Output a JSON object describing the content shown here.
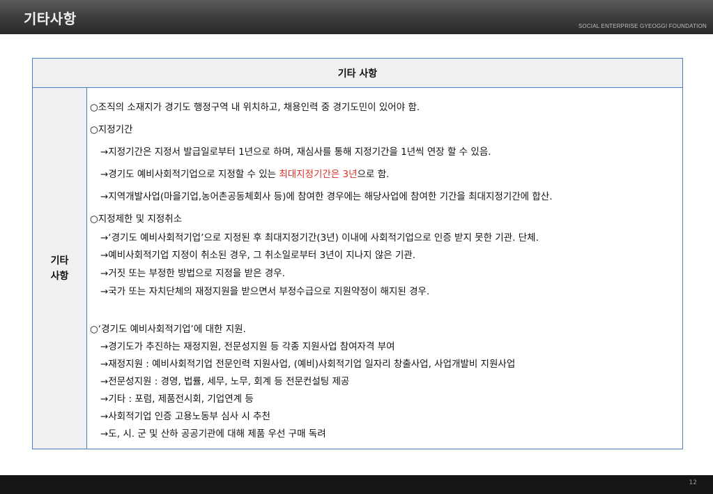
{
  "header": {
    "title": "기타사항",
    "org": "SOCIAL ENTERPRISE GYEOGGI FOUNDATION"
  },
  "table": {
    "header": "기타 사항",
    "side_label": [
      "기타",
      "사항"
    ],
    "lines": [
      {
        "text": "○조직의 소재지가 경기도 행정구역 내 위치하고, 채용인력 중 경기도민이 있어야 함.",
        "sub": false
      },
      {
        "text": "○지정기간",
        "sub": false
      },
      {
        "text": "→지정기간은 지정서 발급일로부터 1년으로 하며, 재심사를 통해 지정기간을 1년씩 연장 할 수 있음.",
        "sub": true
      },
      {
        "text": "",
        "sub": true
      },
      {
        "text": "→지역개발사업(마을기업,농어촌공동체회사 등)에 참여한 경우에는 해당사업에 참여한 기간을 최대지정기간에 합산.",
        "sub": true
      },
      {
        "text": "○지정제한 및 지정취소",
        "sub": false
      },
      {
        "text": "→‘경기도 예비사회적기업’으로 지정된 후 최대지정기간(3년) 이내에 사회적기업으로 인증 받지 못한 기관. 단체.",
        "sub": true
      },
      {
        "text": "→예비사회적기업 지정이 취소된 경우, 그 취소일로부터 3년이 지나지 않은 기관.",
        "sub": true
      },
      {
        "text": "→거짓 또는 부정한 방법으로 지정을 받은 경우.",
        "sub": true
      },
      {
        "text": "→국가 또는 자치단체의 재정지원을 받으면서 부정수급으로 지원약정이 해지된 경우.",
        "sub": true
      },
      {
        "text": "○‘경기도 예비사회적기업’에 대한 지원.",
        "sub": false
      },
      {
        "text": "→경기도가 추진하는 재정지원, 전문성지원 등 각종 지원사업 참여자격 부여",
        "sub": true
      },
      {
        "text": "→재정지원 : 예비사회적기업 전문인력 지원사업, (예비)사회적기업 일자리 창출사업, 사업개발비 지원사업",
        "sub": true
      },
      {
        "text": "→전문성지원 : 경영, 법률, 세무, 노무, 회계 등 전문컨설팅 제공",
        "sub": true
      },
      {
        "text": "→기타 : 포럼, 제품전시회, 기업연계 등",
        "sub": true
      },
      {
        "text": "→사회적기업 인증 고용노동부 심사 시 추천",
        "sub": true
      },
      {
        "text": "→도, 시. 군 및 산하 공공기관에 대해 제품 우선 구매 독려",
        "sub": true
      }
    ],
    "max_period_line": {
      "pre": "→경기도 예비사회적기업으로 지정할 수 있는 ",
      "highlight": "최대지정기간은 3년",
      "post": "으로 함."
    }
  },
  "page_number": "12",
  "colors": {
    "border": "#4a7cc0",
    "highlight": "#e0302a",
    "header_bg": "#3b3b3b",
    "cell_bg": "#f0f0f3"
  }
}
